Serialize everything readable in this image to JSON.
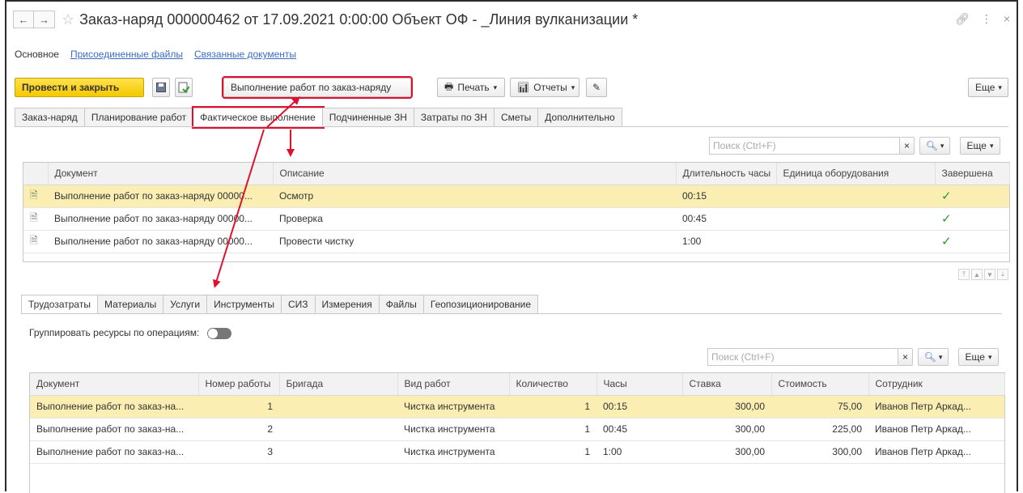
{
  "window": {
    "title": "Заказ-наряд 000000462 от 17.09.2021 0:00:00 Объект ОФ - _Линия вулканизации *",
    "back_icon": "←",
    "forward_icon": "→",
    "star_icon": "☆",
    "link_icon": "🔗",
    "menu_icon": "⋮",
    "close_icon": "×"
  },
  "sections": {
    "main": "Основное",
    "files": "Присоединенные файлы",
    "related": "Связанные документы"
  },
  "toolbar": {
    "post_close": "Провести и закрыть",
    "create_based": "Выполнение работ по заказ-наряду",
    "print": "Печать",
    "reports": "Отчеты",
    "more": "Еще"
  },
  "tabs": [
    "Заказ-наряд",
    "Планирование работ",
    "Фактическое выполнение",
    "Подчиненные ЗН",
    "Затраты по ЗН",
    "Сметы",
    "Дополнительно"
  ],
  "top_search": {
    "placeholder": "Поиск (Ctrl+F)",
    "clear": "×",
    "more": "Еще"
  },
  "top_table": {
    "headers": [
      "Документ",
      "Описание",
      "Длительность часы",
      "Единица оборудования",
      "Завершена"
    ],
    "rows": [
      {
        "doc": "Выполнение работ по заказ-наряду 00000...",
        "desc": "Осмотр",
        "dur": "00:15",
        "equip": "",
        "done": "✓"
      },
      {
        "doc": "Выполнение работ по заказ-наряду 00000...",
        "desc": "Проверка",
        "dur": "00:45",
        "equip": "",
        "done": "✓"
      },
      {
        "doc": "Выполнение работ по заказ-наряду 00000...",
        "desc": "Провести чистку",
        "dur": "1:00",
        "equip": "",
        "done": "✓"
      }
    ]
  },
  "subtabs": [
    "Трудозатраты",
    "Материалы",
    "Услуги",
    "Инструменты",
    "СИЗ",
    "Измерения",
    "Файлы",
    "Геопозиционирование"
  ],
  "group_toggle_label": "Группировать ресурсы по операциям:",
  "bottom_search": {
    "placeholder": "Поиск (Ctrl+F)",
    "clear": "×",
    "more": "Еще"
  },
  "bottom_table": {
    "headers": [
      "Документ",
      "Номер работы",
      "Бригада",
      "Вид работ",
      "Количество",
      "Часы",
      "Ставка",
      "Стоимость",
      "Сотрудник"
    ],
    "rows": [
      {
        "doc": "Выполнение работ по заказ-на...",
        "num": "1",
        "brig": "",
        "kind": "Чистка инструмента",
        "qty": "1",
        "hours": "00:15",
        "rate": "300,00",
        "cost": "75,00",
        "emp": "Иванов Петр Аркад..."
      },
      {
        "doc": "Выполнение работ по заказ-на...",
        "num": "2",
        "brig": "",
        "kind": "Чистка инструмента",
        "qty": "1",
        "hours": "00:45",
        "rate": "300,00",
        "cost": "225,00",
        "emp": "Иванов Петр Аркад..."
      },
      {
        "doc": "Выполнение работ по заказ-на...",
        "num": "3",
        "brig": "",
        "kind": "Чистка инструмента",
        "qty": "1",
        "hours": "1:00",
        "rate": "300,00",
        "cost": "300,00",
        "emp": "Иванов Петр Аркад..."
      }
    ]
  },
  "colors": {
    "highlight": "#e0102c",
    "selected_row": "#fbeeb3",
    "primary_button": "#f5c800",
    "link": "#3a6dc8",
    "check": "#2e9a2e"
  }
}
